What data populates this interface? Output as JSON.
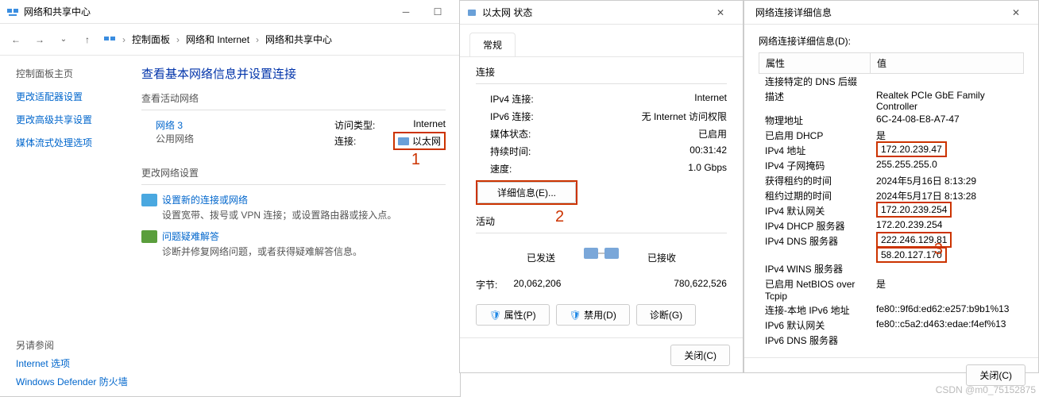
{
  "w1": {
    "title": "网络和共享中心",
    "breadcrumb": [
      "控制面板",
      "网络和 Internet",
      "网络和共享中心"
    ],
    "sidebar": {
      "home": "控制面板主页",
      "adapter": "更改适配器设置",
      "advanced": "更改高级共享设置",
      "media": "媒体流式处理选项",
      "seealso_title": "另请参阅",
      "seealso": [
        "Internet 选项",
        "Windows Defender 防火墙"
      ]
    },
    "heading": "查看基本网络信息并设置连接",
    "sec_active": "查看活动网络",
    "net": {
      "name": "网络 3",
      "type": "公用网络",
      "access_label": "访问类型:",
      "access_value": "Internet",
      "conn_label": "连接:",
      "conn_value": "以太网"
    },
    "sec_change": "更改网络设置",
    "new_conn": "设置新的连接或网络",
    "new_conn_desc": "设置宽带、拨号或 VPN 连接；或设置路由器或接入点。",
    "trouble": "问题疑难解答",
    "trouble_desc": "诊断并修复网络问题，或者获得疑难解答信息。",
    "annot1": "1"
  },
  "w2": {
    "title": "以太网 状态",
    "tab": "常规",
    "conn_title": "连接",
    "rows": {
      "ipv4_label": "IPv4 连接:",
      "ipv4_val": "Internet",
      "ipv6_label": "IPv6 连接:",
      "ipv6_val": "无 Internet 访问权限",
      "media_label": "媒体状态:",
      "media_val": "已启用",
      "dur_label": "持续时间:",
      "dur_val": "00:31:42",
      "speed_label": "速度:",
      "speed_val": "1.0 Gbps"
    },
    "details_btn": "详细信息(E)...",
    "activity_title": "活动",
    "sent": "已发送",
    "recv": "已接收",
    "bytes_label": "字节:",
    "bytes_sent": "20,062,206",
    "bytes_recv": "780,622,526",
    "prop_btn": "属性(P)",
    "disable_btn": "禁用(D)",
    "diag_btn": "诊断(G)",
    "close_btn": "关闭(C)",
    "annot2": "2"
  },
  "w3": {
    "title": "网络连接详细信息",
    "label": "网络连接详细信息(D):",
    "col_prop": "属性",
    "col_val": "值",
    "rows": [
      {
        "p": "连接特定的 DNS 后缀",
        "v": ""
      },
      {
        "p": "描述",
        "v": "Realtek PCIe GbE Family Controller"
      },
      {
        "p": "物理地址",
        "v": "6C-24-08-E8-A7-47"
      },
      {
        "p": "已启用 DHCP",
        "v": "是"
      },
      {
        "p": "IPv4 地址",
        "v": "172.20.239.47"
      },
      {
        "p": "IPv4 子网掩码",
        "v": "255.255.255.0"
      },
      {
        "p": "获得租约的时间",
        "v": "2024年5月16日 8:13:29"
      },
      {
        "p": "租约过期的时间",
        "v": "2024年5月17日 8:13:28"
      },
      {
        "p": "IPv4 默认网关",
        "v": "172.20.239.254"
      },
      {
        "p": "IPv4 DHCP 服务器",
        "v": "172.20.239.254"
      },
      {
        "p": "IPv4 DNS 服务器",
        "v": "222.246.129.81"
      },
      {
        "p": "",
        "v": "58.20.127.170"
      },
      {
        "p": "IPv4 WINS 服务器",
        "v": ""
      },
      {
        "p": "已启用 NetBIOS over Tcpip",
        "v": "是"
      },
      {
        "p": "连接-本地 IPv6 地址",
        "v": "fe80::9f6d:ed62:e257:b9b1%13"
      },
      {
        "p": "IPv6 默认网关",
        "v": "fe80::c5a2:d463:edae:f4ef%13"
      },
      {
        "p": "IPv6 DNS 服务器",
        "v": ""
      }
    ],
    "close_btn": "关闭(C)",
    "annot3": "3"
  },
  "watermark": "CSDN @m0_75152875"
}
